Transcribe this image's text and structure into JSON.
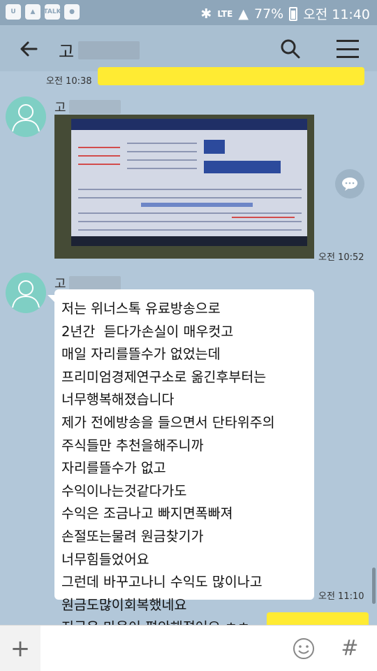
{
  "status_bar": {
    "left_icons": [
      "u-icon",
      "gallery-icon",
      "talk-icon",
      "chat-icon"
    ],
    "talk_label": "TALK",
    "network": "LTE",
    "battery": "77%",
    "time": "오전 11:40"
  },
  "header": {
    "back_icon": "arrow-left-icon",
    "title": "고",
    "search_icon": "search-icon",
    "menu_icon": "menu-icon"
  },
  "messages": [
    {
      "type": "sent",
      "time": "오전 10:38",
      "text": "",
      "bubble_color": "#ffeb33"
    },
    {
      "type": "received-image",
      "sender": "고",
      "time": "오전 10:52"
    },
    {
      "type": "received-text",
      "sender": "고",
      "time": "오전 11:10",
      "lines": [
        "저는 위너스톡 유료방송으로",
        "2년간  듣다가손실이 매우컷고",
        "매일 자리를뜰수가 없었는데",
        "프리미엄경제연구소로 옮긴후부터는",
        "너무행복해졌습니다",
        "제가 전에방송을 들으면서 단타위주의",
        "주식들만 추천을해주니까",
        "자리를뜰수가 없고",
        "수익이나는것같다가도",
        "수익은 조금나고 빠지면폭빠져",
        "손절또는물려 원금찾기가",
        "너무힘들었어요",
        "그런데 바꾸고나니 수익도 많이나고",
        "원금도많이회복했네요",
        "지금은 마음이 편안해졌어요 ㅎㅎ"
      ]
    },
    {
      "type": "sent",
      "time": "",
      "text": "",
      "bubble_color": "#ffeb33"
    }
  ],
  "share_icon": "share-chat-icon",
  "input": {
    "plus_icon": "plus-icon",
    "placeholder": "",
    "emoji_icon": "emoticon-icon",
    "hash_icon": "hash-icon",
    "hash_label": "#",
    "plus_label": "+"
  },
  "colors": {
    "chat_background": "#b2c7d9",
    "my_bubble": "#ffeb33",
    "their_bubble": "#ffffff",
    "avatar": "#7fcfc4"
  }
}
